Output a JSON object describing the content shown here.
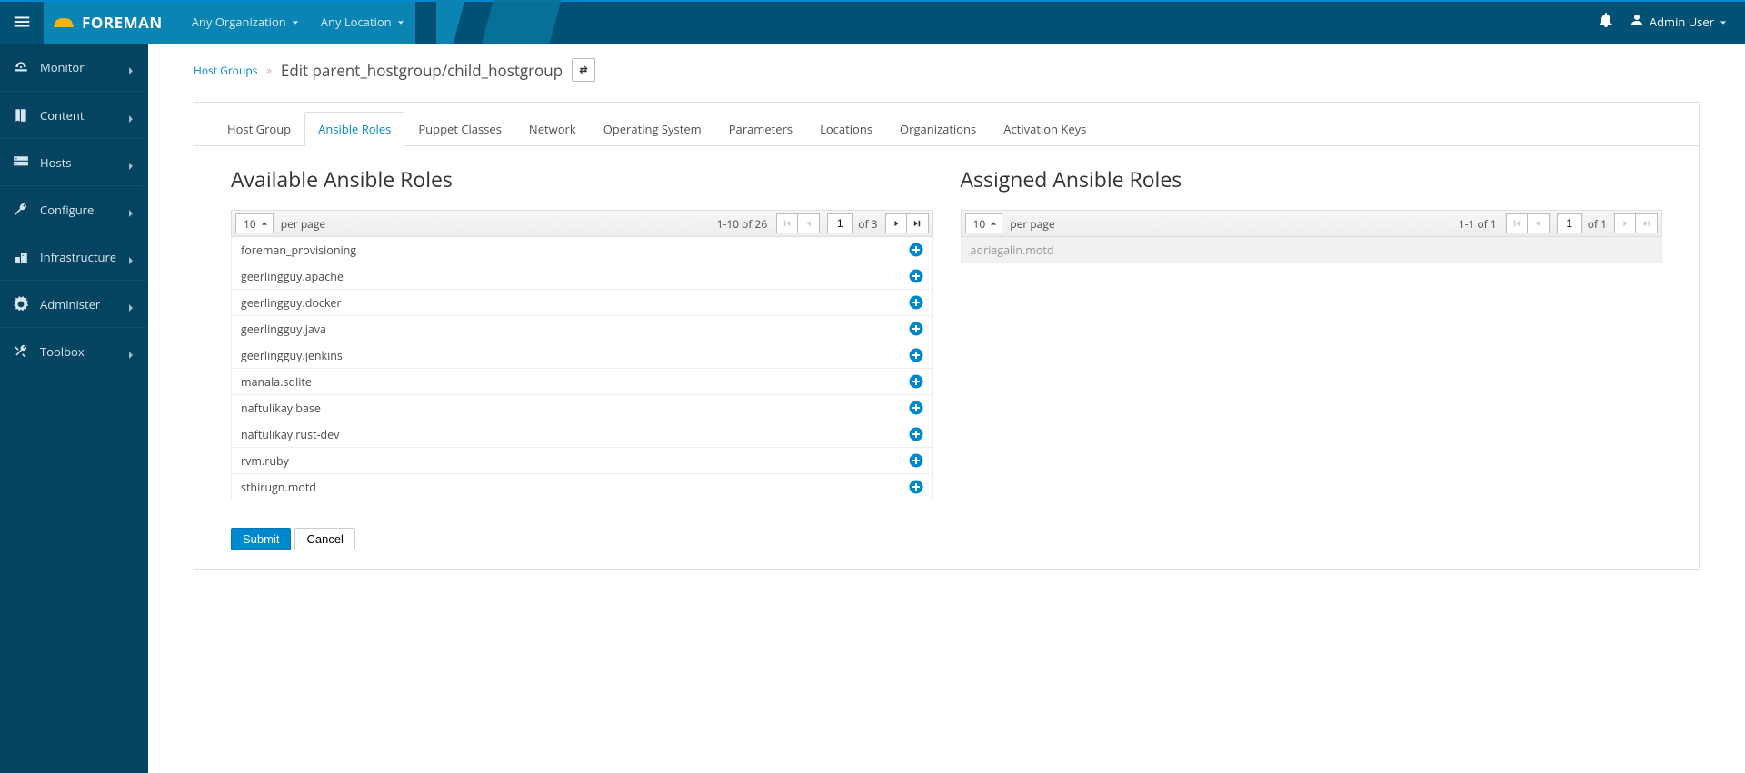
{
  "header": {
    "brand": "FOREMAN",
    "org_selector": "Any Organization",
    "loc_selector": "Any Location",
    "user": "Admin User"
  },
  "sidebar": {
    "items": [
      {
        "label": "Monitor",
        "icon": "dashboard"
      },
      {
        "label": "Content",
        "icon": "book"
      },
      {
        "label": "Hosts",
        "icon": "server"
      },
      {
        "label": "Configure",
        "icon": "wrench"
      },
      {
        "label": "Infrastructure",
        "icon": "building"
      },
      {
        "label": "Administer",
        "icon": "cog"
      },
      {
        "label": "Toolbox",
        "icon": "tools"
      }
    ]
  },
  "breadcrumb": {
    "parent": "Host Groups",
    "current": "Edit parent_hostgroup/child_hostgroup"
  },
  "tabs": [
    {
      "label": "Host Group"
    },
    {
      "label": "Ansible Roles",
      "active": true
    },
    {
      "label": "Puppet Classes"
    },
    {
      "label": "Network"
    },
    {
      "label": "Operating System"
    },
    {
      "label": "Parameters"
    },
    {
      "label": "Locations"
    },
    {
      "label": "Organizations"
    },
    {
      "label": "Activation Keys"
    }
  ],
  "available": {
    "title": "Available Ansible Roles",
    "per_page": "10",
    "per_page_label": "per page",
    "range": "1-10 of 26",
    "page": "1",
    "of_pages": "of 3",
    "roles": [
      "foreman_provisioning",
      "geerlingguy.apache",
      "geerlingguy.docker",
      "geerlingguy.java",
      "geerlingguy.jenkins",
      "manala.sqlite",
      "naftulikay.base",
      "naftulikay.rust-dev",
      "rvm.ruby",
      "sthirugn.motd"
    ]
  },
  "assigned": {
    "title": "Assigned Ansible Roles",
    "per_page": "10",
    "per_page_label": "per page",
    "range": "1-1 of 1",
    "page": "1",
    "of_pages": "of 1",
    "roles": [
      "adriagalin.motd"
    ]
  },
  "actions": {
    "submit": "Submit",
    "cancel": "Cancel"
  }
}
